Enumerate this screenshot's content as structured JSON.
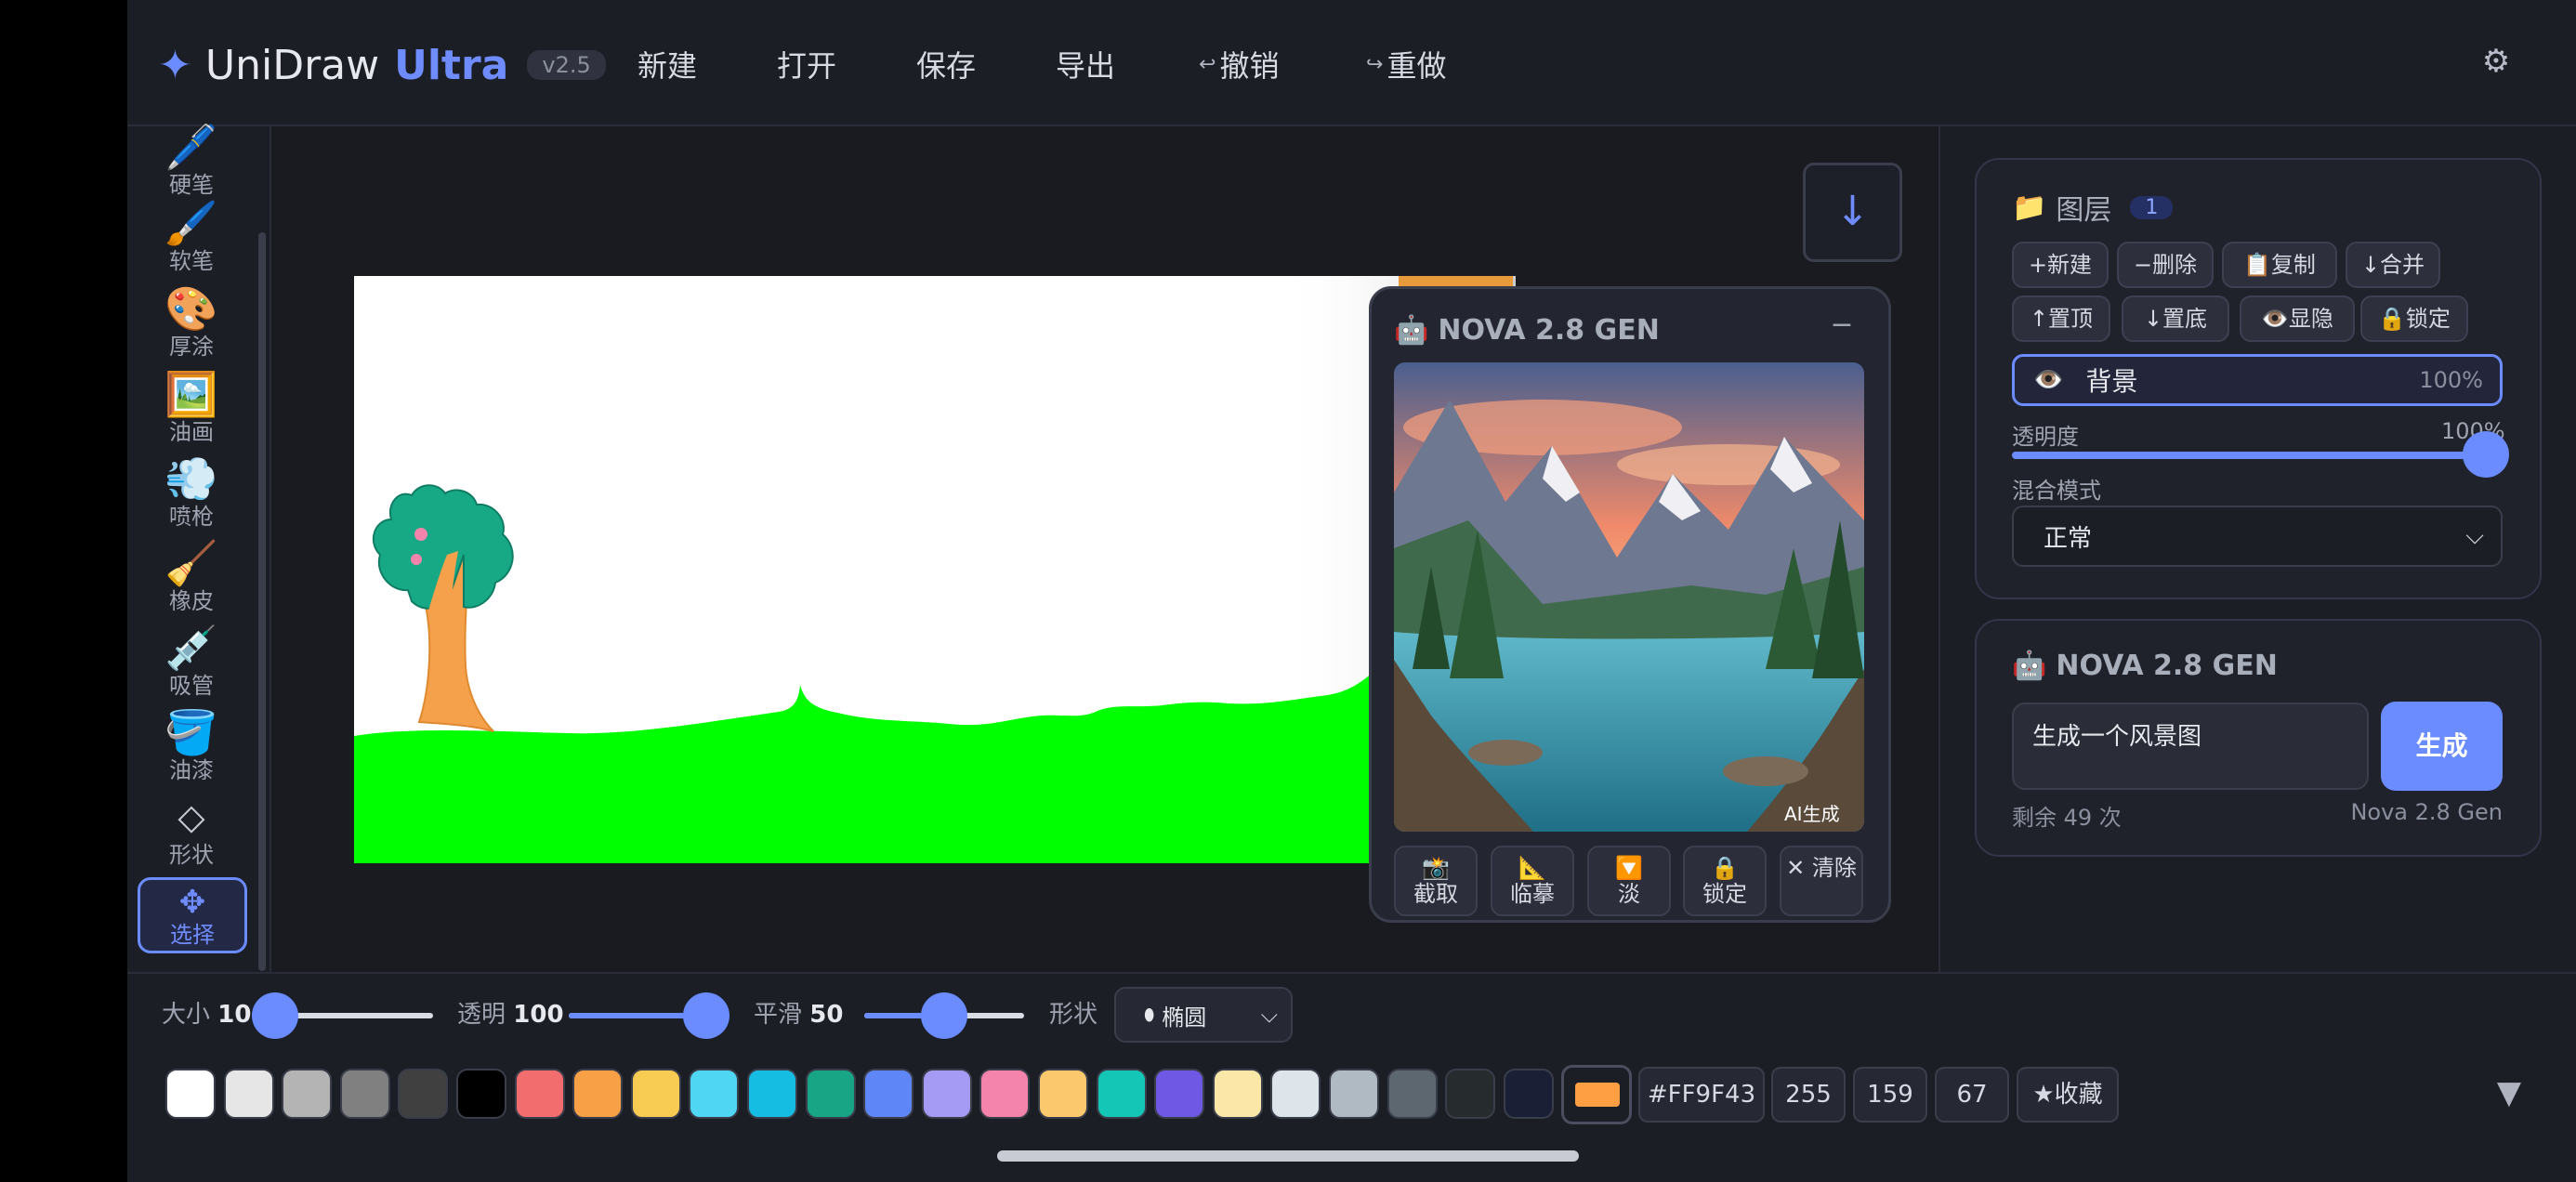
{
  "app": {
    "name": "UniDraw",
    "edition": "Ultra",
    "version": "v2.5"
  },
  "menu": [
    {
      "label": "新建",
      "icon": ""
    },
    {
      "label": "打开",
      "icon": ""
    },
    {
      "label": "保存",
      "icon": ""
    },
    {
      "label": "导出",
      "icon": ""
    },
    {
      "label": "撤销",
      "icon": "↩"
    },
    {
      "label": "重做",
      "icon": "↪"
    }
  ],
  "tools": [
    {
      "label": "硬笔",
      "icon": "🖊️"
    },
    {
      "label": "软笔",
      "icon": "🖌️"
    },
    {
      "label": "厚涂",
      "icon": "🎨"
    },
    {
      "label": "油画",
      "icon": "🖼️"
    },
    {
      "label": "喷枪",
      "icon": "💨"
    },
    {
      "label": "橡皮",
      "icon": "🧹"
    },
    {
      "label": "吸管",
      "icon": "💉"
    },
    {
      "label": "油漆",
      "icon": "🪣"
    },
    {
      "label": "形状",
      "icon": "◇"
    },
    {
      "label": "选择",
      "icon": "✥",
      "active": true
    }
  ],
  "nova_float": {
    "title": "NOVA 2.8 GEN",
    "ai_tag": "AI生成",
    "actions": [
      {
        "icon": "📸",
        "label": "截取"
      },
      {
        "icon": "📐",
        "label": "临摹"
      },
      {
        "icon": "🔽",
        "label": "淡"
      },
      {
        "icon": "🔒",
        "label": "锁定"
      },
      {
        "icon": "✕",
        "label": "清除"
      }
    ]
  },
  "layers": {
    "title": "图层",
    "count": "1",
    "buttons_row1": [
      "+新建",
      "−删除",
      "📋复制",
      "↓合并"
    ],
    "buttons_row2": [
      "↑置顶",
      "↓置底",
      "👁️显隐",
      "🔒锁定"
    ],
    "items": [
      {
        "name": "背景",
        "opacity": "100%"
      }
    ],
    "opacity_label": "透明度",
    "opacity_value": "100%",
    "opacity_fraction": 1.0,
    "blend_label": "混合模式",
    "blend_value": "正常"
  },
  "nova_panel": {
    "title": "NOVA 2.8 GEN",
    "prompt": "生成一个风景图",
    "generate": "生成",
    "remaining": "剩余 49 次",
    "model": "Nova 2.8 Gen"
  },
  "brush": {
    "size_label": "大小",
    "size_value": "10",
    "size_fraction": 0.0,
    "opacity_label": "透明",
    "opacity_value": "100",
    "opacity_fraction": 1.0,
    "smooth_label": "平滑",
    "smooth_value": "50",
    "smooth_fraction": 0.5,
    "shape_label": "形状",
    "shape_value": "椭圆"
  },
  "palette": [
    "#ffffff",
    "#e6e6e6",
    "#b4b4b4",
    "#808080",
    "#404040",
    "#000000",
    "#f26d6d",
    "#f7a046",
    "#f8cb52",
    "#4fd6f2",
    "#16bde2",
    "#17a586",
    "#5f86f6",
    "#a59bf5",
    "#f484ac",
    "#fcc86d",
    "#14c6b5",
    "#6e58e4",
    "#fbe7a8",
    "#dde4ea",
    "#b0bac3",
    "#5c6770",
    "#262c2e",
    "#1a1f36"
  ],
  "current_color": {
    "hex": "#FF9F43",
    "r": "255",
    "g": "159",
    "b": "67",
    "favorite": "★收藏",
    "swatch": "#ff9f43"
  },
  "colors": {
    "accent": "#6a8cff",
    "grass": "#00ff00",
    "tree_crown": "#17a986",
    "tree_trunk": "#f5a04b"
  }
}
